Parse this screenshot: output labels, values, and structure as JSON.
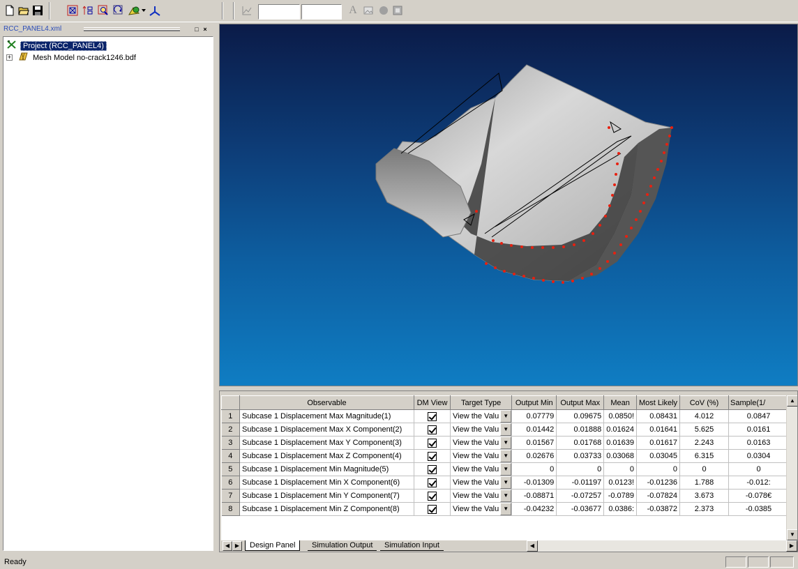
{
  "toolbar": {
    "buttons": [
      "new-file-icon",
      "open-folder-icon",
      "save-disk-icon",
      "fit-view-icon",
      "transform-icon",
      "zoom-icon",
      "rotate-icon",
      "material-icon",
      "dropdown-arrow-icon",
      "axes-icon",
      "graph-icon",
      "font-icon",
      "image-icon",
      "sphere-icon",
      "panel-icon"
    ]
  },
  "tree": {
    "pane_title": "RCC_PANEL4.xml",
    "project_label": "Project (RCC_PANEL4)",
    "mesh_label": "Mesh Model no-crack1246.bdf"
  },
  "grid": {
    "columns": [
      "Observable",
      "DM View",
      "Target Type",
      "Output Min",
      "Output Max",
      "Mean",
      "Most Likely",
      "CoV (%)",
      "Sample(1/"
    ],
    "rows": [
      {
        "n": "1",
        "observable": "Subcase 1 Displacement Max Magnitude(1)",
        "target": "View the Valu",
        "min": "0.07779",
        "max": "0.09675",
        "mean": "0.0850!",
        "likely": "0.08431",
        "cov": "4.012",
        "sample": "0.0847"
      },
      {
        "n": "2",
        "observable": "Subcase 1 Displacement Max X Component(2)",
        "target": "View the Valu",
        "min": "0.01442",
        "max": "0.01888",
        "mean": "0.01624",
        "likely": "0.01641",
        "cov": "5.625",
        "sample": "0.0161"
      },
      {
        "n": "3",
        "observable": "Subcase 1 Displacement Max Y Component(3)",
        "target": "View the Valu",
        "min": "0.01567",
        "max": "0.01768",
        "mean": "0.01639",
        "likely": "0.01617",
        "cov": "2.243",
        "sample": "0.0163"
      },
      {
        "n": "4",
        "observable": "Subcase 1 Displacement Max Z Component(4)",
        "target": "View the Valu",
        "min": "0.02676",
        "max": "0.03733",
        "mean": "0.03068",
        "likely": "0.03045",
        "cov": "6.315",
        "sample": "0.0304"
      },
      {
        "n": "5",
        "observable": "Subcase 1 Displacement Min Magnitude(5)",
        "target": "View the Valu",
        "min": "0",
        "max": "0",
        "mean": "0",
        "likely": "0",
        "cov": "0",
        "sample": "0"
      },
      {
        "n": "6",
        "observable": "Subcase 1 Displacement Min X Component(6)",
        "target": "View the Valu",
        "min": "-0.01309",
        "max": "-0.01197",
        "mean": "0.0123!",
        "likely": "-0.01236",
        "cov": "1.788",
        "sample": "-0.012:"
      },
      {
        "n": "7",
        "observable": "Subcase 1 Displacement Min Y Component(7)",
        "target": "View the Valu",
        "min": "-0.08871",
        "max": "-0.07257",
        "mean": "-0.0789",
        "likely": "-0.07824",
        "cov": "3.673",
        "sample": "-0.078€"
      },
      {
        "n": "8",
        "observable": "Subcase 1 Displacement Min Z Component(8)",
        "target": "View the Valu",
        "min": "-0.04232",
        "max": "-0.03677",
        "mean": "0.0386:",
        "likely": "-0.03872",
        "cov": "2.373",
        "sample": "-0.0385"
      }
    ]
  },
  "tabs": [
    "Design Panel",
    "Simulation Output",
    "Simulation Input"
  ],
  "status": {
    "text": "Ready"
  }
}
